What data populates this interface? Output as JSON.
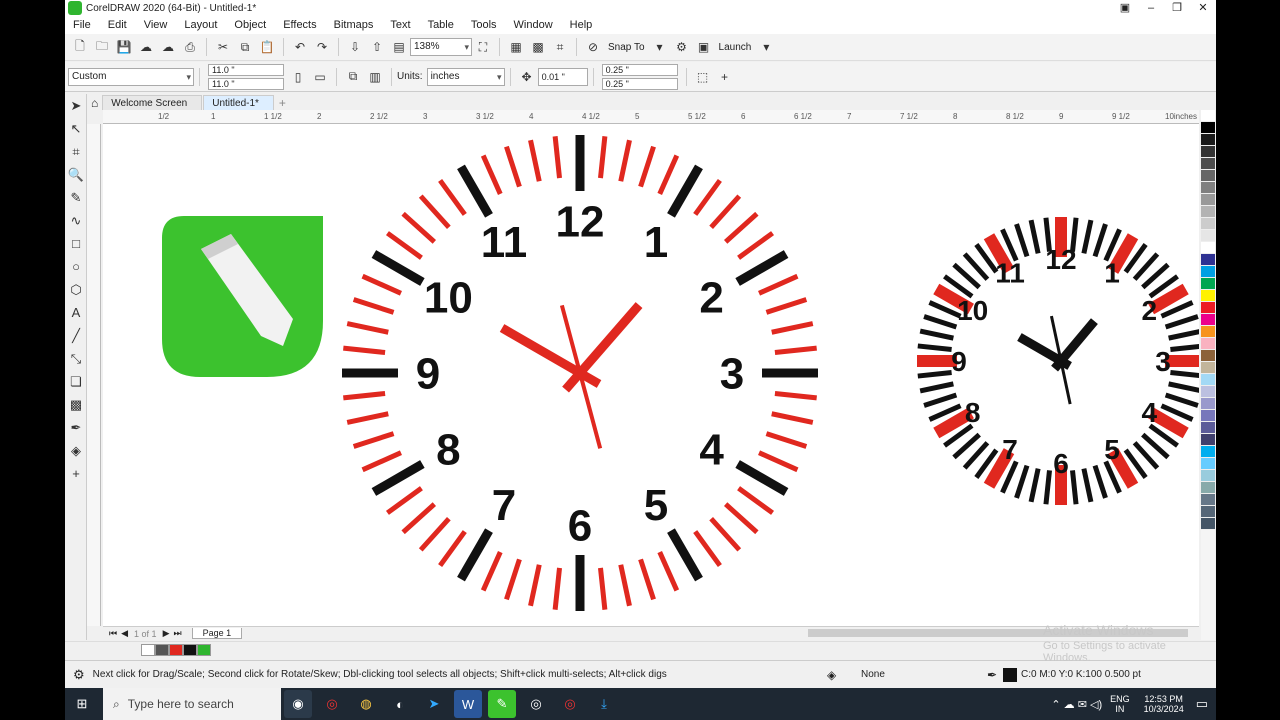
{
  "window": {
    "title": "CorelDRAW 2020 (64-Bit) - Untitled-1*"
  },
  "menu": [
    "File",
    "Edit",
    "View",
    "Layout",
    "Object",
    "Effects",
    "Bitmaps",
    "Text",
    "Table",
    "Tools",
    "Window",
    "Help"
  ],
  "toolbar1": {
    "zoom": "138%",
    "snap_to": "Snap To",
    "launch": "Launch"
  },
  "toolbar2": {
    "page_size": "Custom",
    "width": "11.0 \"",
    "height": "11.0 \"",
    "units_label": "Units:",
    "units": "inches",
    "nudge": "0.01 \"",
    "dup_x": "0.25 \"",
    "dup_y": "0.25 \""
  },
  "tabs": [
    {
      "label": "Welcome Screen"
    },
    {
      "label": "Untitled-1*"
    }
  ],
  "ruler": {
    "units": "inches",
    "labels": [
      "1/2",
      "1",
      "1 1/2",
      "2",
      "2 1/2",
      "3",
      "3 1/2",
      "4",
      "4 1/2",
      "5",
      "5 1/2",
      "6",
      "6 1/2",
      "7",
      "7 1/2",
      "8",
      "8 1/2",
      "9",
      "9 1/2",
      "10"
    ]
  },
  "clock_large": {
    "numbers": [
      "12",
      "1",
      "2",
      "3",
      "4",
      "5",
      "6",
      "7",
      "8",
      "9",
      "10",
      "11"
    ],
    "hand_color": "#e0281f"
  },
  "clock_small": {
    "numbers": [
      "12",
      "1",
      "2",
      "3",
      "4",
      "5",
      "6",
      "7",
      "8",
      "9",
      "10",
      "11"
    ],
    "hand_color": "#111111"
  },
  "docbar": {
    "page_counter": "1 of 1",
    "page_tab": "Page 1"
  },
  "status": {
    "hint": "Next click for Drag/Scale; Second click for Rotate/Skew; Dbl-clicking tool selects all objects; Shift+click multi-selects; Alt+click digs",
    "fill": "None",
    "outline": "C:0 M:0 Y:0 K:100  0.500 pt"
  },
  "watermark": {
    "line1": "Activate Windows",
    "line2": "Go to Settings to activate Windows."
  },
  "taskbar": {
    "search_placeholder": "Type here to search",
    "lang": "ENG",
    "region": "IN",
    "time": "12:53 PM",
    "date": "10/3/2024"
  },
  "colors": {
    "logo_green": "#3cc22e",
    "accent_red": "#e0281f",
    "ink": "#111111"
  },
  "palette": [
    "#ffffff",
    "#000000",
    "#1a1a1a",
    "#333333",
    "#4d4d4d",
    "#666666",
    "#808080",
    "#999999",
    "#b3b3b3",
    "#cccccc",
    "#e6e6e6",
    "#ffffff",
    "#2e3192",
    "#00a0e3",
    "#00a651",
    "#fff200",
    "#ed1c24",
    "#ec008c",
    "#f7941d",
    "#f9b2c0",
    "#8c6239",
    "#c2b59b",
    "#a3d9f5",
    "#bcc0e0",
    "#9999cc",
    "#7777bb",
    "#5c5c99",
    "#40406e",
    "#00aeef",
    "#66ccff",
    "#99ccdd",
    "#88aaaa",
    "#667788",
    "#556677",
    "#445566"
  ]
}
